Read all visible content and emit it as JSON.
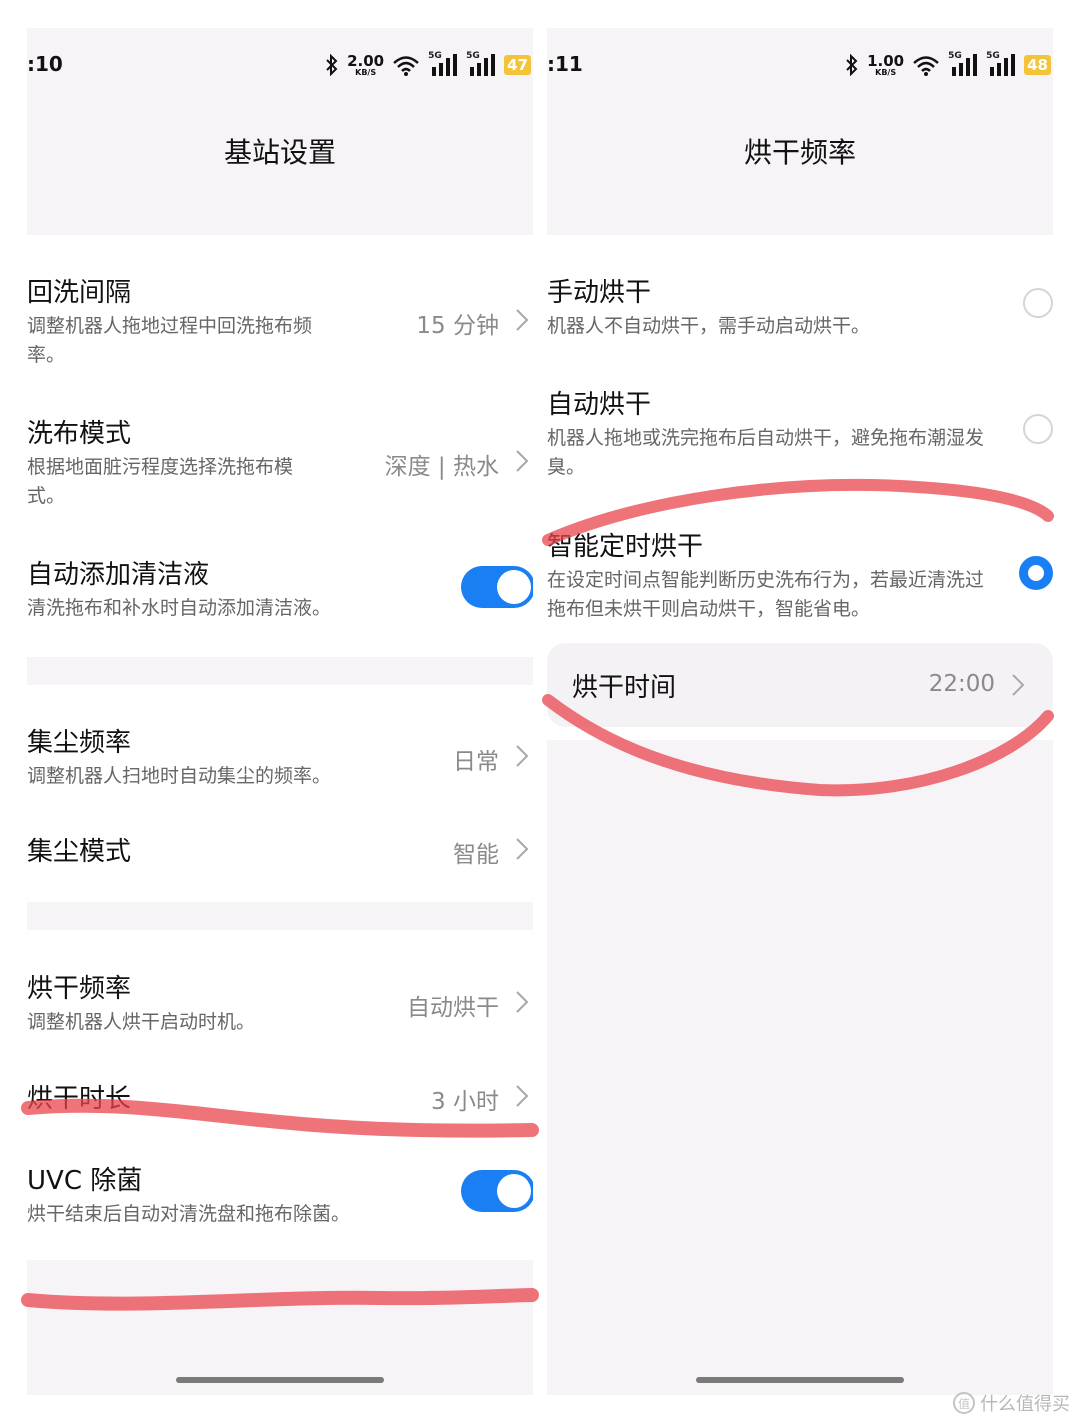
{
  "left": {
    "status": {
      "time": ":10",
      "speed": "2.00",
      "speed_unit": "KB/S",
      "net1": "5G",
      "net2": "5G",
      "battery": "47"
    },
    "title": "基站设置",
    "items": [
      {
        "label": "回洗间隔",
        "desc": "调整机器人拖地过程中回洗拖布频率。",
        "value": "15 分钟"
      },
      {
        "label": "洗布模式",
        "desc": "根据地面脏污程度选择洗拖布模式。",
        "value": "深度 | 热水"
      },
      {
        "label": "自动添加清洁液",
        "desc": "清洗拖布和补水时自动添加清洁液。",
        "toggle": true
      },
      {
        "label": "集尘频率",
        "desc": "调整机器人扫地时自动集尘的频率。",
        "value": "日常"
      },
      {
        "label": "集尘模式",
        "value": "智能"
      },
      {
        "label": "烘干频率",
        "desc": "调整机器人烘干启动时机。",
        "value": "自动烘干"
      },
      {
        "label": "烘干时长",
        "value": "3 小时"
      },
      {
        "label": "UVC 除菌",
        "desc": "烘干结束后自动对清洗盘和拖布除菌。",
        "toggle": true
      }
    ]
  },
  "right": {
    "status": {
      "time": ":11",
      "speed": "1.00",
      "speed_unit": "KB/S",
      "net1": "5G",
      "net2": "5G",
      "battery": "48"
    },
    "title": "烘干频率",
    "options": [
      {
        "label": "手动烘干",
        "desc": "机器人不自动烘干，需手动启动烘干。",
        "selected": false
      },
      {
        "label": "自动烘干",
        "desc": "机器人拖地或洗完拖布后自动烘干，避免拖布潮湿发臭。",
        "selected": false
      },
      {
        "label": "智能定时烘干",
        "desc": "在设定时间点智能判断历史洗布行为，若最近清洗过拖布但未烘干则启动烘干，智能省电。",
        "selected": true
      }
    ],
    "dry_time": {
      "label": "烘干时间",
      "value": "22:00"
    }
  },
  "colors": {
    "accent": "#1a7ff2",
    "annotation": "#e8464e",
    "header_bg": "#f7f4f7"
  },
  "watermark": {
    "text": "什么值得买",
    "icon": "值"
  }
}
